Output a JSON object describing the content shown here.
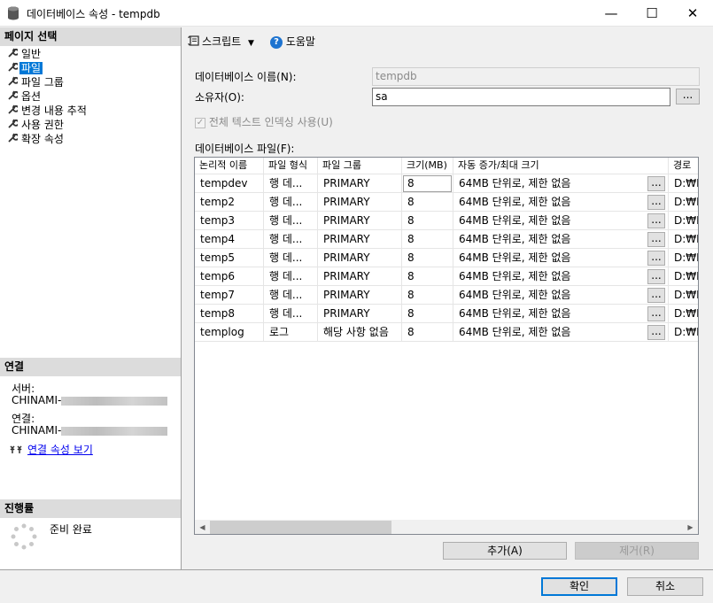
{
  "window": {
    "title": "데이터베이스 속성 - tempdb",
    "minimize": "—",
    "maximize": "☐",
    "close": "✕"
  },
  "left": {
    "pages_header": "페이지 선택",
    "pages": [
      {
        "label": "일반"
      },
      {
        "label": "파일"
      },
      {
        "label": "파일 그룹"
      },
      {
        "label": "옵션"
      },
      {
        "label": "변경 내용 추적"
      },
      {
        "label": "사용 권한"
      },
      {
        "label": "확장 속성"
      }
    ],
    "connection_header": "연결",
    "server_label": "서버:",
    "server_value": "CHINAMI-",
    "conn_label": "연결:",
    "conn_value": "CHINAMI-",
    "view_conn_props": "연결 속성 보기",
    "progress_header": "진행률",
    "progress_status": "준비 완료"
  },
  "toolbar": {
    "script": "스크립트",
    "help": "도움말"
  },
  "form": {
    "db_name_label": "데이터베이스 이름(N):",
    "db_name_value": "tempdb",
    "owner_label": "소유자(O):",
    "owner_value": "sa",
    "browse": "...",
    "fulltext_label": "전체 텍스트 인덱싱 사용(U)",
    "files_label": "데이터베이스 파일(F):"
  },
  "grid": {
    "columns": [
      "논리적 이름",
      "파일 형식",
      "파일 그룹",
      "크기(MB)",
      "자동 증가/최대 크기",
      "경로"
    ],
    "rows": [
      {
        "name": "tempdev",
        "type": "행 데...",
        "group": "PRIMARY",
        "size": "8",
        "growth": "64MB 단위로, 제한 없음",
        "btn": "...",
        "path": "D:₩P"
      },
      {
        "name": "temp2",
        "type": "행 데...",
        "group": "PRIMARY",
        "size": "8",
        "growth": "64MB 단위로, 제한 없음",
        "btn": "...",
        "path": "D:₩P"
      },
      {
        "name": "temp3",
        "type": "행 데...",
        "group": "PRIMARY",
        "size": "8",
        "growth": "64MB 단위로, 제한 없음",
        "btn": "...",
        "path": "D:₩P"
      },
      {
        "name": "temp4",
        "type": "행 데...",
        "group": "PRIMARY",
        "size": "8",
        "growth": "64MB 단위로, 제한 없음",
        "btn": "...",
        "path": "D:₩P"
      },
      {
        "name": "temp5",
        "type": "행 데...",
        "group": "PRIMARY",
        "size": "8",
        "growth": "64MB 단위로, 제한 없음",
        "btn": "...",
        "path": "D:₩P"
      },
      {
        "name": "temp6",
        "type": "행 데...",
        "group": "PRIMARY",
        "size": "8",
        "growth": "64MB 단위로, 제한 없음",
        "btn": "...",
        "path": "D:₩P"
      },
      {
        "name": "temp7",
        "type": "행 데...",
        "group": "PRIMARY",
        "size": "8",
        "growth": "64MB 단위로, 제한 없음",
        "btn": "...",
        "path": "D:₩P"
      },
      {
        "name": "temp8",
        "type": "행 데...",
        "group": "PRIMARY",
        "size": "8",
        "growth": "64MB 단위로, 제한 없음",
        "btn": "...",
        "path": "D:₩P"
      },
      {
        "name": "templog",
        "type": "로그",
        "group": "해당 사항 없음",
        "size": "8",
        "growth": "64MB 단위로, 제한 없음",
        "btn": "...",
        "path": "D:₩P"
      }
    ]
  },
  "buttons": {
    "add": "추가(A)",
    "remove": "제거(R)",
    "ok": "확인",
    "cancel": "취소"
  }
}
